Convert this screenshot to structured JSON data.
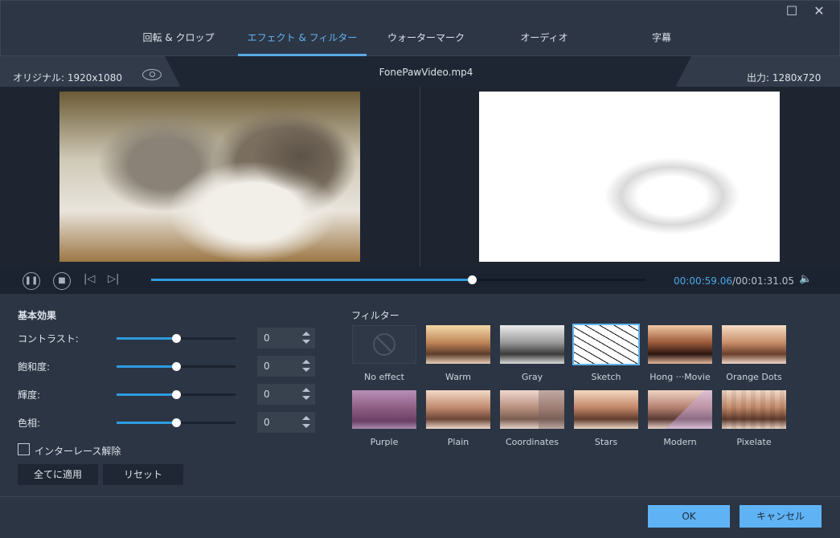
{
  "window": {
    "maximize_icon": "square",
    "close_icon": "X"
  },
  "tabs": [
    {
      "label": "回転 & クロップ"
    },
    {
      "label": "エフェクト & フィルター",
      "active": true
    },
    {
      "label": "ウォーターマーク"
    },
    {
      "label": "オーディオ"
    },
    {
      "label": "字幕"
    }
  ],
  "info": {
    "original": "オリジナル: 1920x1080",
    "filename": "FonePawVideo.mp4",
    "output": "出力: 1280x720"
  },
  "player": {
    "current_time": "00:00:59.06",
    "total_time": "/00:01:31.05",
    "progress": 0.648
  },
  "basic": {
    "title": "基本効果",
    "adjustments": [
      {
        "label": "コントラスト:",
        "value": "0",
        "level": 0.5
      },
      {
        "label": "飽和度:",
        "value": "0",
        "level": 0.5
      },
      {
        "label": "輝度:",
        "value": "0",
        "level": 0.5
      },
      {
        "label": "色相:",
        "value": "0",
        "level": 0.5
      }
    ],
    "deinterlace": "インターレース解除",
    "deinterlace_checked": false,
    "apply_all": "全てに適用",
    "reset": "リセット"
  },
  "filters": {
    "title": "フィルター",
    "selected": "Sketch",
    "items": [
      {
        "label": "No effect"
      },
      {
        "label": "Warm"
      },
      {
        "label": "Gray"
      },
      {
        "label": "Sketch"
      },
      {
        "label": "Hong ···Movie"
      },
      {
        "label": "Orange Dots"
      },
      {
        "label": "Purple"
      },
      {
        "label": "Plain"
      },
      {
        "label": "Coordinates"
      },
      {
        "label": "Stars"
      },
      {
        "label": "Modern"
      },
      {
        "label": "Pixelate"
      }
    ]
  },
  "footer": {
    "ok": "OK",
    "cancel": "キャンセル"
  },
  "colors": {
    "accent": "#5fb3f5",
    "background": "#2b3544"
  }
}
